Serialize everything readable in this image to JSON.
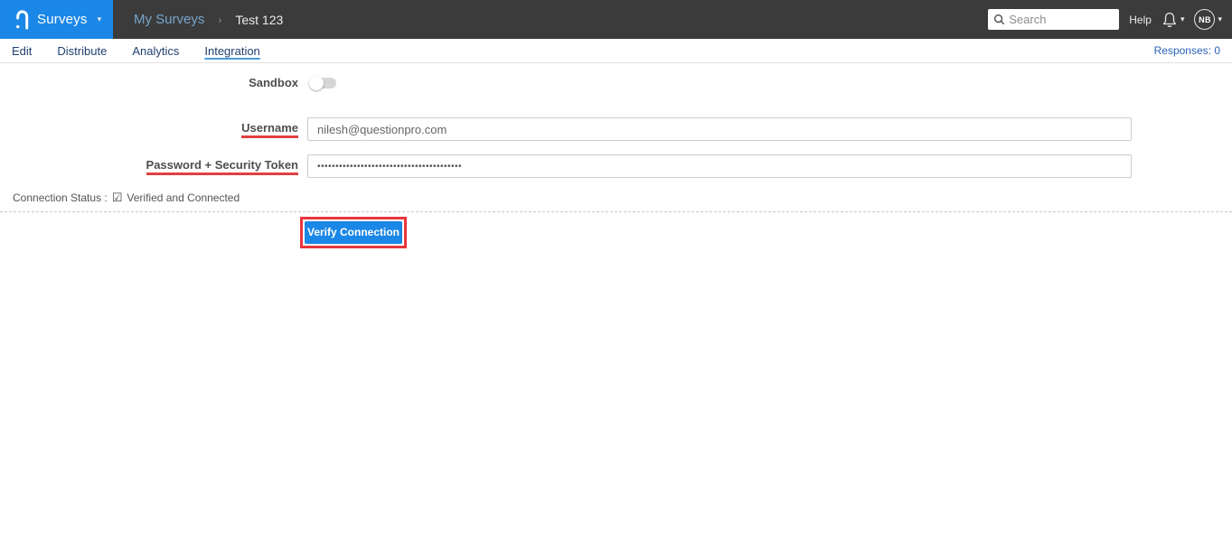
{
  "colors": {
    "brand_blue": "#1b87e6",
    "header_dark": "#3b3b3b",
    "annotation_red": "#e8363d",
    "nav_navy": "#21406f"
  },
  "icons": {
    "caret_down": "▾",
    "checked_box": "☑"
  },
  "header": {
    "product_label": "Surveys",
    "breadcrumb": {
      "parent": "My Surveys",
      "separator": "›",
      "current": "Test 123"
    },
    "search_placeholder": "Search",
    "help_label": "Help",
    "avatar_initials": "NB"
  },
  "nav": {
    "tabs": [
      {
        "label": "Edit"
      },
      {
        "label": "Distribute"
      },
      {
        "label": "Analytics"
      },
      {
        "label": "Integration"
      }
    ],
    "active_tab": "Integration",
    "responses_label": "Responses: 0"
  },
  "form": {
    "sandbox_label": "Sandbox",
    "sandbox_state": "off",
    "username_label": "Username",
    "username_value": "nilesh@questionpro.com",
    "password_label": "Password + Security Token",
    "password_masked_value": "••••••••••••••••••••••••••••••••••••••••",
    "connection_status_label": "Connection Status :",
    "connection_status_value": "Verified and Connected",
    "verify_button_label": "Verify Connection"
  }
}
